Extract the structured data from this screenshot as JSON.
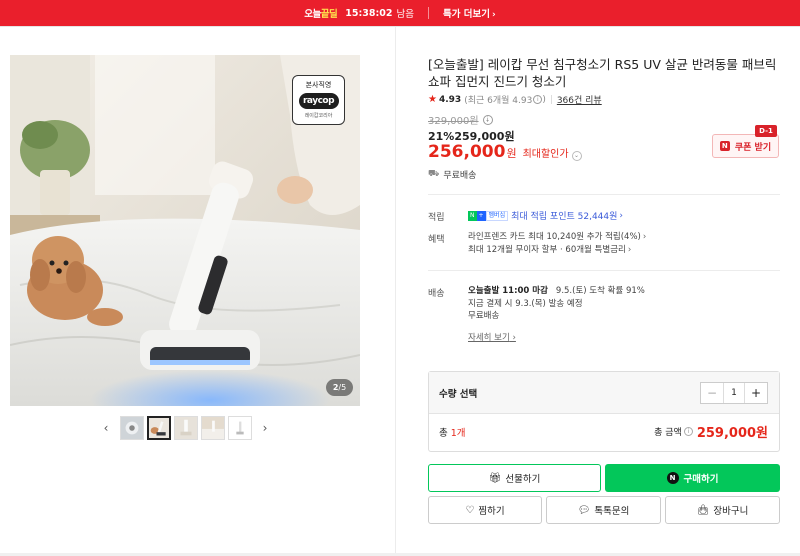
{
  "topbar": {
    "brand_prefix": "오늘",
    "brand_highlight": "끝딜",
    "timer": "15:38:02",
    "timer_suffix": "남음",
    "more_label": "특가 더보기"
  },
  "gallery": {
    "official_badge_top": "본사직영",
    "official_badge_logo": "raycop",
    "official_badge_bottom": "레이캅코리아",
    "counter_current": "2",
    "counter_total": "5",
    "thumb_count": 5,
    "active_thumb": 2
  },
  "product": {
    "title": "[오늘출발] 레이캅 무선 침구청소기 RS5 UV 살균 반려동물 패브릭 쇼파 집먼지 진드기 청소기",
    "rating_score": "4.93",
    "rating_sub": "(최근 6개월 4.93",
    "rating_sub_close": ")",
    "review_count": "366건 리뷰",
    "original_price": "329,000원",
    "discount_pct": "21%",
    "discount_price": "259,000원",
    "final_price": "256,000",
    "final_unit": "원",
    "final_label": "최대할인가",
    "coupon_label": "쿠폰 받기",
    "coupon_tag": "D-1",
    "shipping_free": "무료배송"
  },
  "benefits": {
    "points_label": "적립",
    "points_text": "최대 적립 포인트 52,444원",
    "benefit_label": "혜택",
    "benefit_line1": "라인프렌즈 카드 최대 10,240원 추가 적립(4%)",
    "benefit_line2": "최대 12개월 무이자 할부 · 60개월 특별금리"
  },
  "delivery": {
    "label": "배송",
    "line1_strong": "오늘출발 11:00 마감",
    "line1_rest": "9.5.(토) 도착 확률 91%",
    "line2": "지금 결제 시 9.3.(목) 발송 예정",
    "line3": "무료배송",
    "detail_link": "자세히 보기"
  },
  "quantity": {
    "label": "수량 선택",
    "minus": "−",
    "value": "1",
    "plus": "+",
    "total_prefix": "총 ",
    "total_count": "1개",
    "total_amount_label": "총 금액",
    "total_amount": "259,000원"
  },
  "actions": {
    "gift": "선물하기",
    "buy": "구매하기",
    "wish": "찜하기",
    "talk": "톡톡문의",
    "cart": "장바구니"
  },
  "colors": {
    "topbar_bg": "#ea1f2c",
    "price_red": "#e5261a",
    "naver_green": "#03c75a",
    "point_blue": "#3b5bd9"
  }
}
